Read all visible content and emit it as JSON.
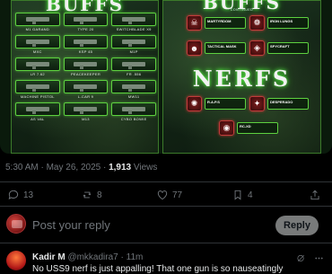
{
  "infographic": {
    "left_title": "BUFFS",
    "right_title": "BUFFS",
    "right_subtitle": "CONTINUED",
    "nerfs_title": "NERFS",
    "weapons": [
      {
        "name": "M1 GARAND"
      },
      {
        "name": "TYPE 20"
      },
      {
        "name": "SWITCHBLADE X9"
      },
      {
        "name": "MXC"
      },
      {
        "name": "KSP 45"
      },
      {
        "name": "M1P"
      },
      {
        "name": "LR 7.62"
      },
      {
        "name": "PEACEKEEPER"
      },
      {
        "name": "FR .556"
      },
      {
        "name": "MACHINE PISTOL"
      },
      {
        "name": "L-CAR 9"
      },
      {
        "name": "MW11"
      },
      {
        "name": "AS VAL"
      },
      {
        "name": "M13"
      },
      {
        "name": "CYBO BOWIE"
      }
    ],
    "buff_perks": [
      {
        "name": "MARTYRDOM",
        "icon": "martyrdom-icon"
      },
      {
        "name": "IRON LUNGS",
        "icon": "iron-lungs-icon"
      },
      {
        "name": "TACTICAL MASK",
        "icon": "tactical-mask-icon"
      },
      {
        "name": "SPYCRAFT",
        "icon": "spycraft-icon"
      }
    ],
    "nerf_items": [
      {
        "name": "R.A.P.S",
        "icon": "raps-icon"
      },
      {
        "name": "DESPERADO",
        "icon": "desperado-icon"
      },
      {
        "name": "RC-XD",
        "icon": "rcxd-icon"
      }
    ],
    "colors": {
      "accent_green": "#5dd13f",
      "nerf_red": "#c23b3b"
    }
  },
  "tweet": {
    "time": "5:30 AM",
    "date": "May 26, 2025",
    "views_count": "1,913",
    "views_label": "Views",
    "replies": "13",
    "reposts": "8",
    "likes": "77",
    "bookmarks": "4"
  },
  "composer": {
    "placeholder": "Post your reply",
    "button": "Reply"
  },
  "reply": {
    "name": "Kadir M",
    "handle": "@mkkadira7",
    "time": "11m",
    "text": "No USS9 nerf is just appalling! That one gun is so nauseatingly"
  }
}
